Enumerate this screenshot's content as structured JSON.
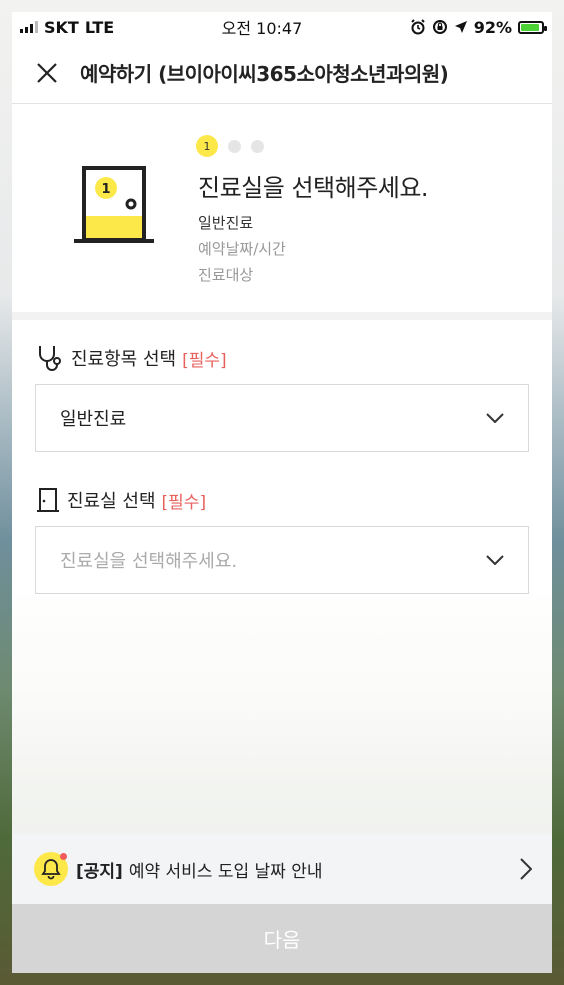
{
  "status_bar": {
    "carrier": "SKT",
    "network": "LTE",
    "time": "오전 10:47",
    "battery": "92%",
    "battery_level": 0.92
  },
  "header": {
    "title": "예약하기 (브이아이씨365소아청소년과의원)",
    "close_icon": "close-icon"
  },
  "steps": {
    "current_step": "1",
    "total_dots": 3,
    "title": "진료실을 선택해주세요.",
    "items": [
      "일반진료",
      "예약날짜/시간",
      "진료대상"
    ]
  },
  "form": {
    "treatment": {
      "label": "진료항목 선택",
      "required": "[필수]",
      "value": "일반진료",
      "icon": "stethoscope-icon"
    },
    "room": {
      "label": "진료실 선택",
      "required": "[필수]",
      "placeholder": "진료실을 선택해주세요.",
      "icon": "door-icon"
    }
  },
  "notice": {
    "tag": "[공지]",
    "text": "예약 서비스 도입 날짜 안내",
    "icon": "bell-icon"
  },
  "next_button": {
    "label": "다음"
  },
  "colors": {
    "accent_yellow": "#fde84a",
    "required_red": "#e8605c",
    "disabled_button": "#d5d5d5"
  }
}
